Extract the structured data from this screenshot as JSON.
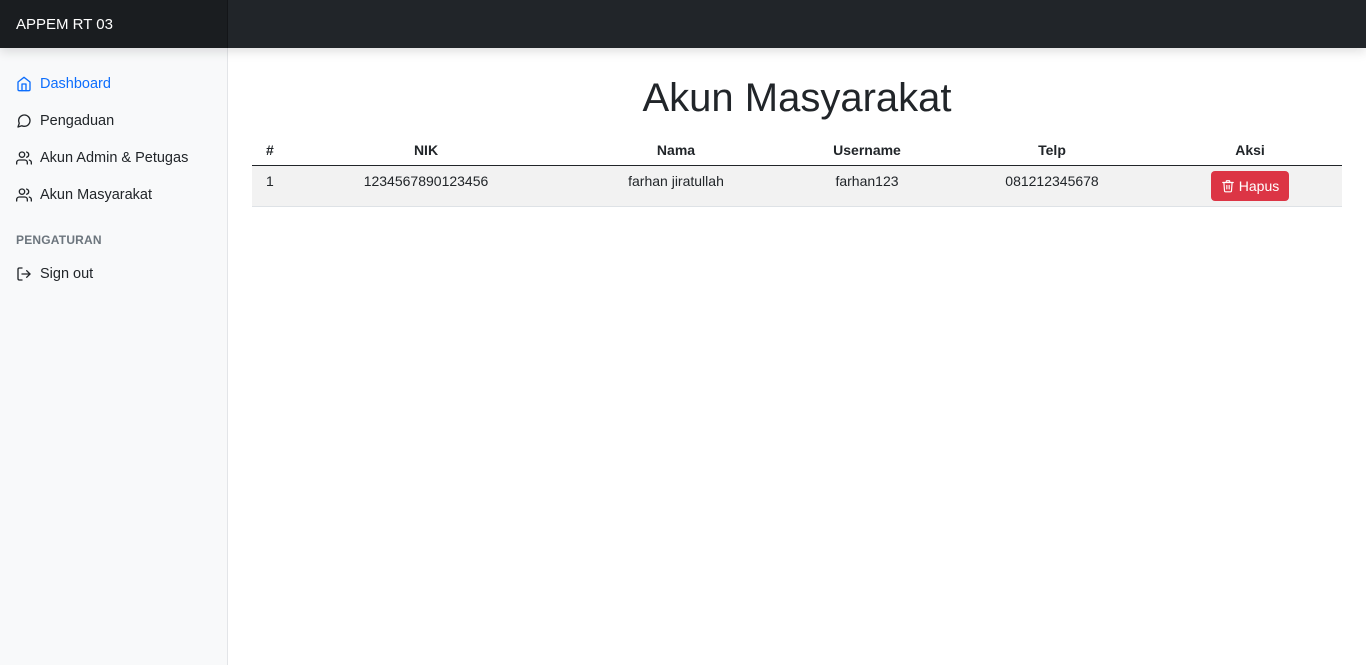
{
  "app": {
    "brand": "APPEM RT 03"
  },
  "sidebar": {
    "items": [
      {
        "label": "Dashboard",
        "icon": "home-icon",
        "active": true
      },
      {
        "label": "Pengaduan",
        "icon": "message-circle-icon"
      },
      {
        "label": "Akun Admin & Petugas",
        "icon": "users-icon"
      },
      {
        "label": "Akun Masyarakat",
        "icon": "users-icon"
      }
    ],
    "section_heading": "PENGATURAN",
    "settings_items": [
      {
        "label": "Sign out",
        "icon": "log-out-icon"
      }
    ]
  },
  "main": {
    "title": "Akun Masyarakat",
    "table": {
      "headers": [
        "#",
        "NIK",
        "Nama",
        "Username",
        "Telp",
        "Aksi"
      ],
      "rows": [
        {
          "no": "1",
          "nik": "1234567890123456",
          "nama": "farhan jiratullah",
          "username": "farhan123",
          "telp": "081212345678",
          "action_label": "Hapus"
        }
      ]
    }
  },
  "colors": {
    "topbar": "#212529",
    "accent": "#0d6efd",
    "danger": "#dc3545",
    "sidebar_bg": "#f8f9fa"
  }
}
